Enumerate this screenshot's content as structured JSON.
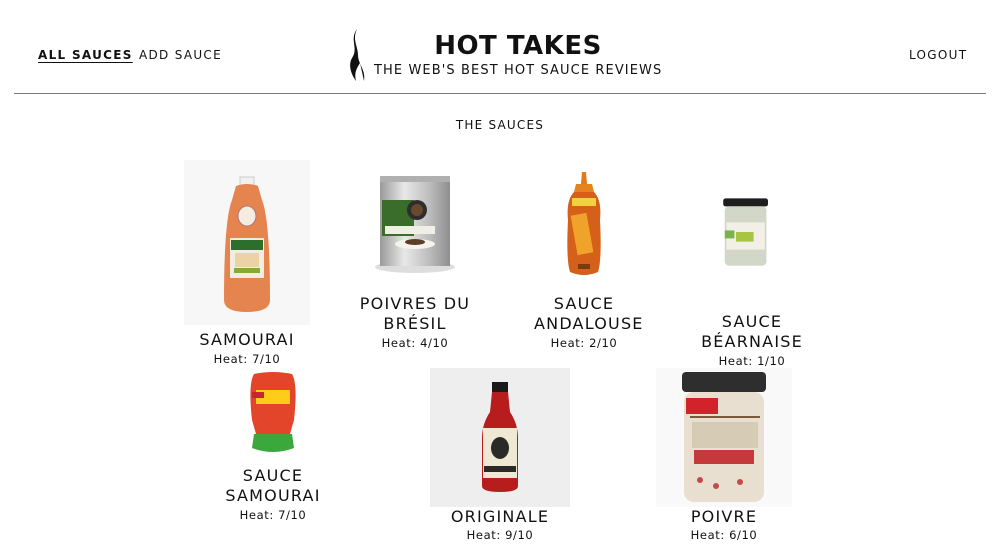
{
  "nav": {
    "all_sauces": "ALL SAUCES",
    "add_sauce": "ADD SAUCE",
    "logout": "LOGOUT"
  },
  "header": {
    "title": "HOT TAKES",
    "tagline": "THE WEB'S BEST HOT SAUCE REVIEWS",
    "logo_icon": "flame-icon"
  },
  "main": {
    "section_title": "THE SAUCES",
    "sauces": [
      {
        "name": "SAMOURAI",
        "heat": "Heat: 7/10",
        "image_icon": "heinz-squeeze-bottle"
      },
      {
        "name": "POIVRES DU BRÉSIL",
        "heat": "Heat: 4/10",
        "image_icon": "metal-tin-can"
      },
      {
        "name": "SAUCE ANDALOUSE",
        "heat": "Heat: 2/10",
        "image_icon": "bouchons-squeeze-bottle"
      },
      {
        "name": "SAUCE BÉARNAISE",
        "heat": "Heat: 1/10",
        "image_icon": "clovis-glass-jar"
      },
      {
        "name": "SAUCE SAMOURAI",
        "heat": "Heat: 7/10",
        "image_icon": "samourai-squeeze-bottle"
      },
      {
        "name": "ORIGINALE",
        "heat": "Heat: 9/10",
        "image_icon": "stubbs-glass-bottle"
      },
      {
        "name": "POIVRE",
        "heat": "Heat: 6/10",
        "image_icon": "amora-glass-jar"
      }
    ]
  },
  "colors": {
    "text": "#111111",
    "rule": "#777777",
    "background": "#ffffff"
  }
}
